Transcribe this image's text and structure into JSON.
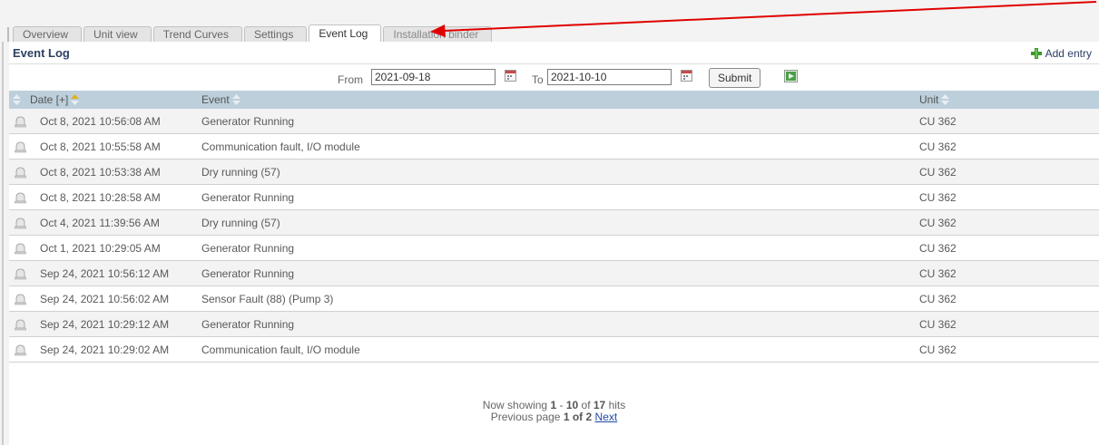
{
  "tabs": [
    {
      "label": "Overview",
      "active": false
    },
    {
      "label": "Unit view",
      "active": false
    },
    {
      "label": "Trend Curves",
      "active": false
    },
    {
      "label": "Settings",
      "active": false
    },
    {
      "label": "Event Log",
      "active": true
    },
    {
      "label": "Installation binder",
      "active": false
    }
  ],
  "section": {
    "title": "Event Log",
    "add_entry_label": "Add entry"
  },
  "filter": {
    "from_label": "From",
    "from_value": "2021-09-18",
    "to_label": "To",
    "to_value": "2021-10-10",
    "submit_label": "Submit"
  },
  "table": {
    "headers": {
      "date": "Date [+]",
      "event": "Event",
      "unit": "Unit"
    },
    "rows": [
      {
        "date": "Oct 8, 2021 10:56:08 AM",
        "event": "Generator Running",
        "unit": "CU 362"
      },
      {
        "date": "Oct 8, 2021 10:55:58 AM",
        "event": "Communication fault, I/O module",
        "unit": "CU 362"
      },
      {
        "date": "Oct 8, 2021 10:53:38 AM",
        "event": "Dry running (57)",
        "unit": "CU 362"
      },
      {
        "date": "Oct 8, 2021 10:28:58 AM",
        "event": "Generator Running",
        "unit": "CU 362"
      },
      {
        "date": "Oct 4, 2021 11:39:56 AM",
        "event": "Dry running (57)",
        "unit": "CU 362"
      },
      {
        "date": "Oct 1, 2021 10:29:05 AM",
        "event": "Generator Running",
        "unit": "CU 362"
      },
      {
        "date": "Sep 24, 2021 10:56:12 AM",
        "event": "Generator Running",
        "unit": "CU 362"
      },
      {
        "date": "Sep 24, 2021 10:56:02 AM",
        "event": "Sensor Fault (88) (Pump 3)",
        "unit": "CU 362"
      },
      {
        "date": "Sep 24, 2021 10:29:12 AM",
        "event": "Generator Running",
        "unit": "CU 362"
      },
      {
        "date": "Sep 24, 2021 10:29:02 AM",
        "event": "Communication fault, I/O module",
        "unit": "CU 362"
      }
    ]
  },
  "pager": {
    "showing_prefix": "Now showing",
    "range_start": "1",
    "range_sep": "-",
    "range_end": "10",
    "of_label": "of",
    "total": "17",
    "hits_label": "hits",
    "previous_label": "Previous page",
    "page_current": "1",
    "page_of_label": "of",
    "page_total": "2",
    "next_label": "Next"
  },
  "colors": {
    "header_bg": "#bccfdb",
    "title_color": "#2d3f63",
    "annotation_arrow": "#e00000",
    "add_icon": "#3a9a2a"
  },
  "icons": {
    "add": "plus-icon",
    "calendar": "calendar-icon",
    "export": "export-icon",
    "sort": "sort-icon",
    "event": "bell-icon"
  }
}
